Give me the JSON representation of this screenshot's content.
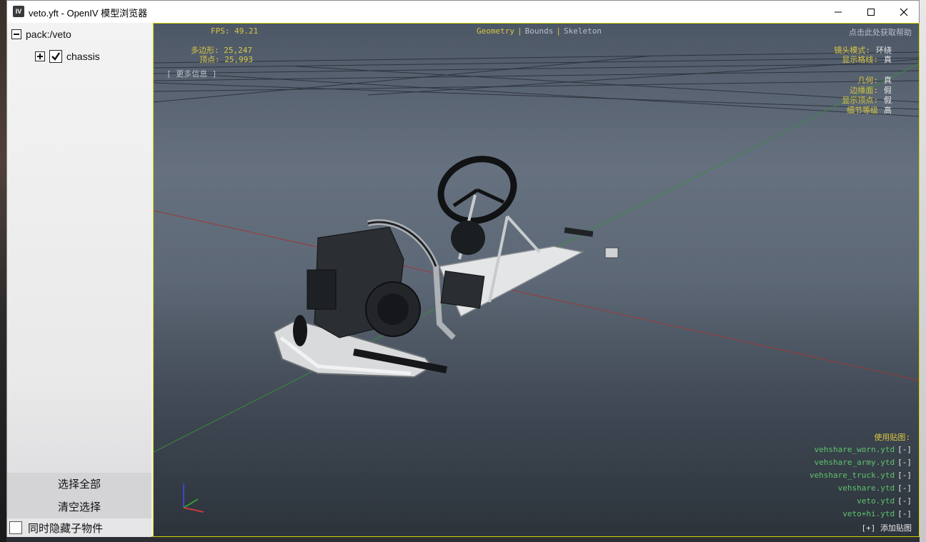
{
  "window": {
    "title": "veto.yft - OpenIV 模型浏览器",
    "app_icon": "IV"
  },
  "tree": {
    "root": "pack:/veto",
    "child": "chassis",
    "child_checked": true
  },
  "left_buttons": {
    "select_all": "选择全部",
    "clear_selection": "清空选择",
    "hide_children": "同时隐藏子物件"
  },
  "hud": {
    "fps": "FPS: 49.21",
    "polygons": "多边形: 25,247",
    "vertices": "顶点: 25,993",
    "more_info": "[ 更多信息 ]",
    "tabs": [
      "Geometry",
      "Bounds",
      "Skeleton"
    ],
    "help": "点击此处获取帮助",
    "camera_mode_label": "镜头模式:",
    "camera_mode_value": "环绕",
    "show_grid_label": "显示格线:",
    "show_grid_value": "真",
    "geometry_label": "几何:",
    "geometry_value": "真",
    "edges_label": "边缘面:",
    "edges_value": "假",
    "show_vertices_label": "显示顶点:",
    "show_vertices_value": "假",
    "lod_label": "细节等级",
    "lod_value": "高",
    "textures_title": "使用贴图:",
    "textures": [
      "vehshare_worn.ytd",
      "vehshare_army.ytd",
      "vehshare_truck.ytd",
      "vehshare.ytd",
      "veto.ytd",
      "veto+hi.ytd"
    ],
    "remove_btn": "[-]",
    "add_texture": "[+] 添加贴图"
  },
  "colors": {
    "hud_yellow": "#d8c640",
    "hud_green": "#5ec46a",
    "viewport_border": "#d0d000"
  }
}
